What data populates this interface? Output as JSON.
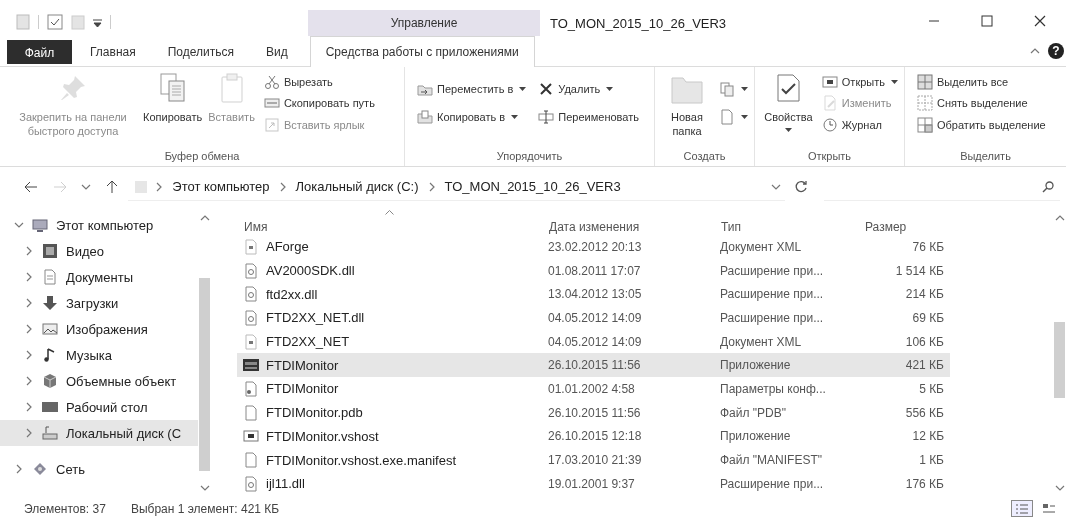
{
  "context_tab_header": "Управление",
  "window": {
    "title": "TO_MON_2015_10_26_VER3"
  },
  "tabs": [
    {
      "label": "Файл",
      "kind": "file",
      "selected": false
    },
    {
      "label": "Главная",
      "kind": "normal",
      "selected": false
    },
    {
      "label": "Поделиться",
      "kind": "normal",
      "selected": false
    },
    {
      "label": "Вид",
      "kind": "normal",
      "selected": false
    },
    {
      "label": "Средства работы с приложениями",
      "kind": "normal",
      "selected": true
    }
  ],
  "help": "?",
  "ribbon": {
    "groups": [
      {
        "label": "Буфер обмена",
        "columns": [
          {
            "kind": "large",
            "label": "Закрепить на панели быстрого доступа",
            "disabled": true
          },
          {
            "kind": "large",
            "label": "Копировать",
            "disabled": false
          },
          {
            "kind": "large",
            "label": "Вставить",
            "disabled": true
          },
          {
            "kind": "stack",
            "items": [
              {
                "label": "Вырезать",
                "disabled": false
              },
              {
                "label": "Скопировать путь",
                "disabled": false
              },
              {
                "label": "Вставить ярлык",
                "disabled": true
              }
            ]
          }
        ]
      },
      {
        "label": "Упорядочить",
        "columns": [
          {
            "kind": "stack",
            "items": [
              {
                "label": "Переместить в",
                "dropdown": true,
                "disabled": false
              },
              {
                "label": "Копировать в",
                "dropdown": true,
                "disabled": false
              }
            ]
          },
          {
            "kind": "stack",
            "items": [
              {
                "label": "Удалить",
                "dropdown": true,
                "disabled": false
              },
              {
                "label": "Переименовать",
                "disabled": false
              }
            ]
          }
        ]
      },
      {
        "label": "Создать",
        "columns": [
          {
            "kind": "large",
            "label": "Новая папка",
            "disabled": false
          },
          {
            "kind": "stack",
            "items": [
              {
                "dropdown": true,
                "disabled": false
              },
              {
                "dropdown": true,
                "disabled": false
              }
            ]
          }
        ]
      },
      {
        "label": "Открыть",
        "columns": [
          {
            "kind": "large",
            "label": "Свойства",
            "dropdown": true,
            "disabled": false
          },
          {
            "kind": "stack",
            "items": [
              {
                "label": "Открыть",
                "dropdown": true,
                "disabled": false
              },
              {
                "label": "Изменить",
                "disabled": true
              },
              {
                "label": "Журнал",
                "disabled": false
              }
            ]
          }
        ]
      },
      {
        "label": "Выделить",
        "columns": [
          {
            "kind": "stack",
            "items": [
              {
                "label": "Выделить все",
                "disabled": false
              },
              {
                "label": "Снять выделение",
                "disabled": false
              },
              {
                "label": "Обратить выделение",
                "disabled": false
              }
            ]
          }
        ]
      }
    ]
  },
  "navigation": {
    "back": {
      "disabled": false
    },
    "forward": {
      "disabled": true
    }
  },
  "address": {
    "segments": [
      "Этот компьютер",
      "Локальный диск (C:)",
      "TO_MON_2015_10_26_VER3"
    ]
  },
  "sidebar": {
    "items": [
      {
        "label": "Этот компьютер",
        "kind": "computer",
        "expanded": true,
        "selected": false,
        "children": [
          {
            "label": "Видео",
            "kind": "video",
            "expanded": false,
            "selected": false
          },
          {
            "label": "Документы",
            "kind": "documents",
            "expanded": false,
            "selected": false
          },
          {
            "label": "Загрузки",
            "kind": "downloads",
            "expanded": false,
            "selected": false
          },
          {
            "label": "Изображения",
            "kind": "pictures",
            "expanded": false,
            "selected": false
          },
          {
            "label": "Музыка",
            "kind": "music",
            "expanded": false,
            "selected": false
          },
          {
            "label": "Объемные объект",
            "kind": "objects",
            "expanded": false,
            "selected": false
          },
          {
            "label": "Рабочий стол",
            "kind": "desktop",
            "expanded": false,
            "selected": false
          },
          {
            "label": "Локальный диск (C",
            "kind": "drive",
            "expanded": false,
            "selected": true
          }
        ]
      },
      {
        "label": "Сеть",
        "kind": "network",
        "expanded": false,
        "selected": false
      }
    ]
  },
  "table": {
    "columns": [
      "Имя",
      "Дата изменения",
      "Тип",
      "Размер"
    ],
    "rows": [
      {
        "kind": "xml",
        "name": "AForge",
        "date": "23.02.2012 20:13",
        "type": "Документ XML",
        "size": "76 КБ",
        "selected": false
      },
      {
        "kind": "dll",
        "name": "AV2000SDK.dll",
        "date": "01.08.2011 17:07",
        "type": "Расширение при...",
        "size": "1 514 КБ",
        "selected": false
      },
      {
        "kind": "dll",
        "name": "ftd2xx.dll",
        "date": "13.04.2012 13:05",
        "type": "Расширение при...",
        "size": "214 КБ",
        "selected": false
      },
      {
        "kind": "dll",
        "name": "FTD2XX_NET.dll",
        "date": "04.05.2012 14:09",
        "type": "Расширение при...",
        "size": "69 КБ",
        "selected": false
      },
      {
        "kind": "xml",
        "name": "FTD2XX_NET",
        "date": "04.05.2012 14:09",
        "type": "Документ XML",
        "size": "106 КБ",
        "selected": false
      },
      {
        "kind": "app",
        "name": "FTDIMonitor",
        "date": "26.10.2015 11:56",
        "type": "Приложение",
        "size": "421 КБ",
        "selected": true
      },
      {
        "kind": "config",
        "name": "FTDIMonitor",
        "date": "01.01.2002 4:58",
        "type": "Параметры конф...",
        "size": "5 КБ",
        "selected": false
      },
      {
        "kind": "file",
        "name": "FTDIMonitor.pdb",
        "date": "26.10.2015 11:56",
        "type": "Файл \"PDB\"",
        "size": "556 КБ",
        "selected": false
      },
      {
        "kind": "vshost",
        "name": "FTDIMonitor.vshost",
        "date": "26.10.2015 12:18",
        "type": "Приложение",
        "size": "12 КБ",
        "selected": false
      },
      {
        "kind": "file",
        "name": "FTDIMonitor.vshost.exe.manifest",
        "date": "17.03.2010 21:39",
        "type": "Файл \"MANIFEST\"",
        "size": "1 КБ",
        "selected": false
      },
      {
        "kind": "dll",
        "name": "ijl11.dll",
        "date": "19.01.2001 9:37",
        "type": "Расширение при...",
        "size": "176 КБ",
        "selected": false
      }
    ]
  },
  "status_bar": {
    "count": "Элементов: 37",
    "selection": "Выбран 1 элемент: 421 КБ"
  },
  "view_buttons": [
    {
      "kind": "details",
      "selected": true
    },
    {
      "kind": "tiles",
      "selected": false
    }
  ]
}
